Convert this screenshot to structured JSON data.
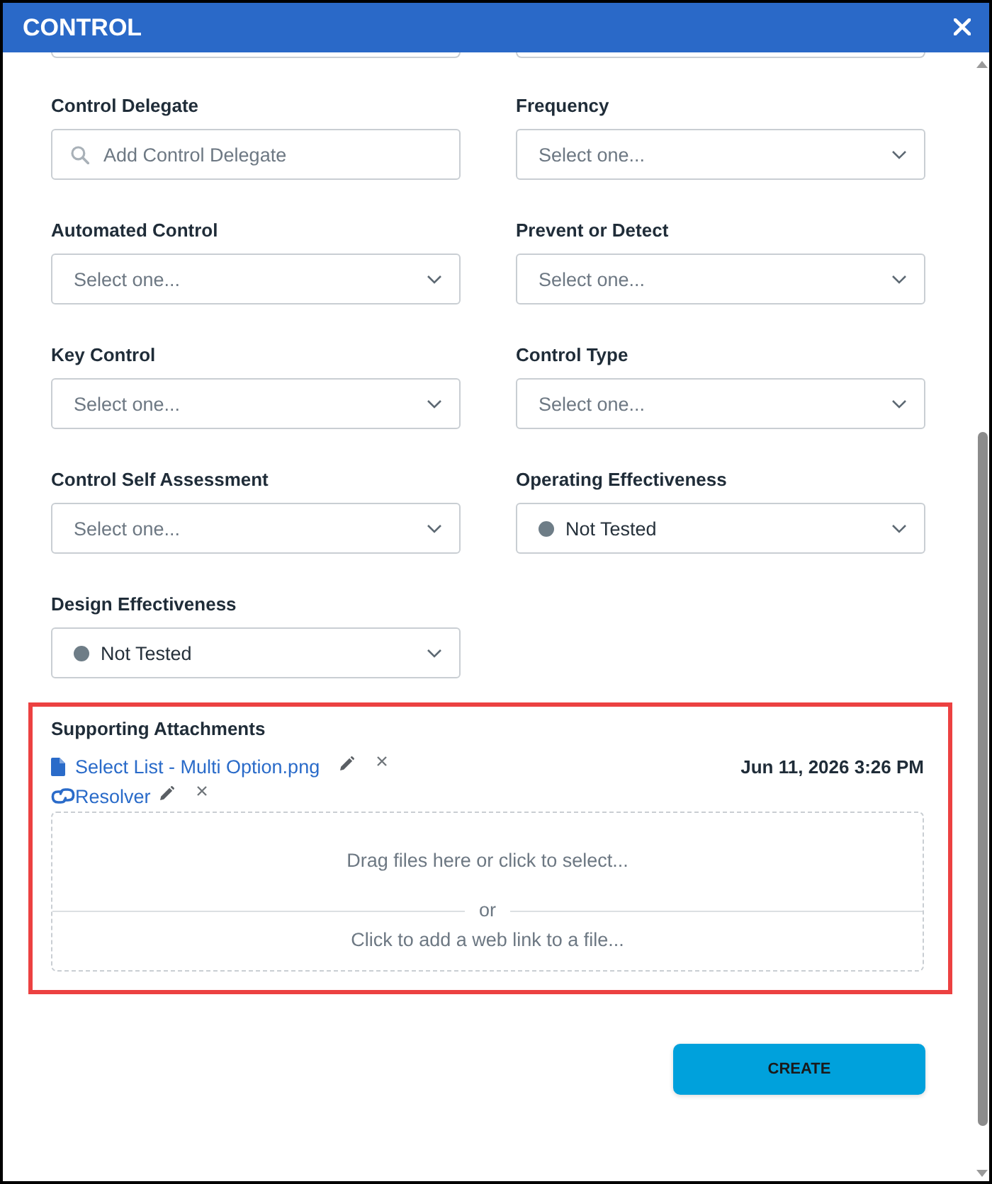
{
  "dialog": {
    "title": "CONTROL"
  },
  "fields": [
    {
      "label": "Control Delegate",
      "kind": "search",
      "placeholder": "Add Control Delegate"
    },
    {
      "label": "Frequency",
      "kind": "select",
      "placeholder": "Select one..."
    },
    {
      "label": "Automated Control",
      "kind": "select",
      "placeholder": "Select one..."
    },
    {
      "label": "Prevent or Detect",
      "kind": "select",
      "placeholder": "Select one..."
    },
    {
      "label": "Key Control",
      "kind": "select",
      "placeholder": "Select one..."
    },
    {
      "label": "Control Type",
      "kind": "select",
      "placeholder": "Select one..."
    },
    {
      "label": "Control Self Assessment",
      "kind": "select",
      "placeholder": "Select one..."
    },
    {
      "label": "Operating Effectiveness",
      "kind": "select",
      "value": "Not Tested",
      "color": "#6e7d87"
    },
    {
      "label": "Design Effectiveness",
      "kind": "select",
      "value": "Not Tested",
      "color": "#6e7d87"
    }
  ],
  "attachments": {
    "title": "Supporting Attachments",
    "highlighted": true,
    "items": [
      {
        "kind": "file",
        "name": "Select List - Multi Option.png",
        "date": "Jun 11, 2026 3:26 PM"
      },
      {
        "kind": "link",
        "name": "Resolver"
      }
    ],
    "dropzone": {
      "drop_text": "Drag files here or click to select...",
      "separator": "or",
      "link_text": "Click to add a web link to a file..."
    }
  },
  "buttons": [
    {
      "label": "CREATE",
      "kind": "primary"
    }
  ]
}
